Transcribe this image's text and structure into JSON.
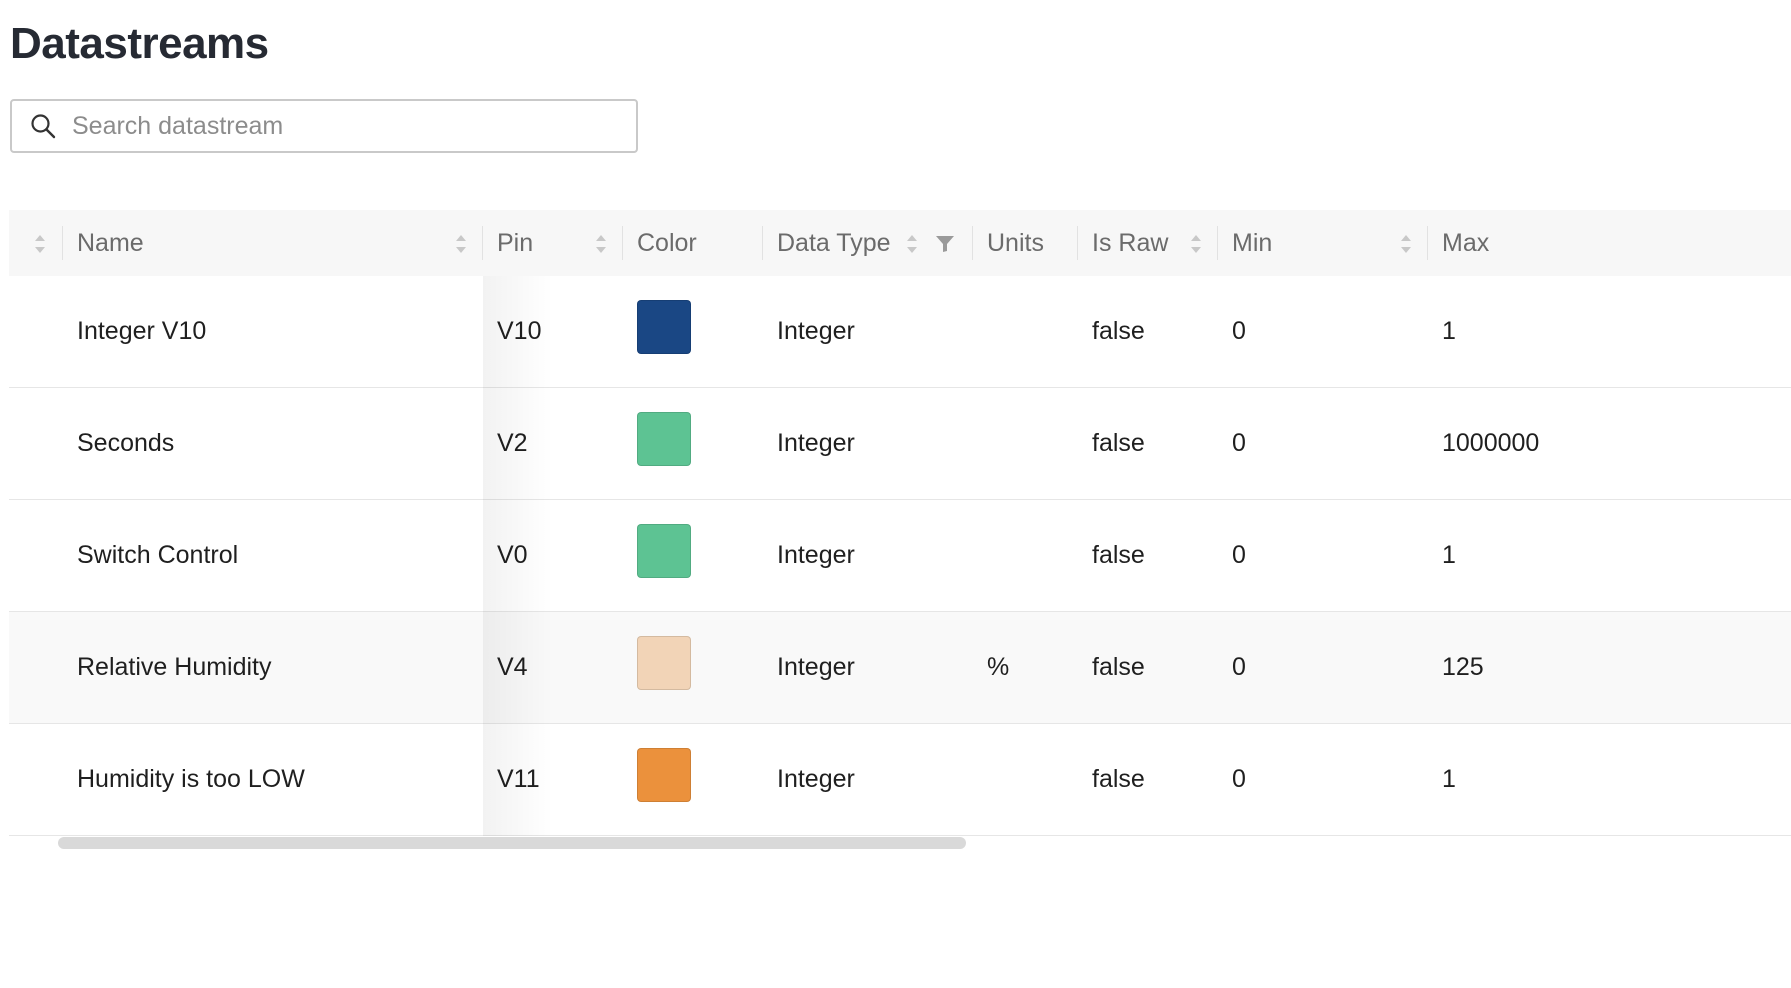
{
  "page": {
    "title": "Datastreams"
  },
  "search": {
    "placeholder": "Search datastream",
    "icon": "search-icon"
  },
  "table": {
    "columns": [
      {
        "label": "",
        "sortable": true
      },
      {
        "label": "Name",
        "sortable": true
      },
      {
        "label": "Pin",
        "sortable": true
      },
      {
        "label": "Color",
        "sortable": false
      },
      {
        "label": "Data Type",
        "sortable": true,
        "filterable": true
      },
      {
        "label": "Units",
        "sortable": false
      },
      {
        "label": "Is Raw",
        "sortable": true
      },
      {
        "label": "Min",
        "sortable": true
      },
      {
        "label": "Max",
        "sortable": false
      }
    ],
    "rows": [
      {
        "name": "Integer V10",
        "pin": "V10",
        "color": "#1a4784",
        "data_type": "Integer",
        "units": "",
        "is_raw": "false",
        "min": "0",
        "max": "1"
      },
      {
        "name": "Seconds",
        "pin": "V2",
        "color": "#5dc393",
        "data_type": "Integer",
        "units": "",
        "is_raw": "false",
        "min": "0",
        "max": "1000000"
      },
      {
        "name": "Switch Control",
        "pin": "V0",
        "color": "#5dc393",
        "data_type": "Integer",
        "units": "",
        "is_raw": "false",
        "min": "0",
        "max": "1"
      },
      {
        "name": "Relative Humidity",
        "pin": "V4",
        "color": "#f2d4b7",
        "data_type": "Integer",
        "units": "%",
        "is_raw": "false",
        "min": "0",
        "max": "125"
      },
      {
        "name": "Humidity is too LOW",
        "pin": "V11",
        "color": "#eb913c",
        "data_type": "Integer",
        "units": "",
        "is_raw": "false",
        "min": "0",
        "max": "1"
      }
    ]
  },
  "colors": {
    "header_bg": "#f7f7f7",
    "hover_row_bg": "#f9f9f9",
    "border": "#e6e6e6",
    "title": "#262a33"
  }
}
